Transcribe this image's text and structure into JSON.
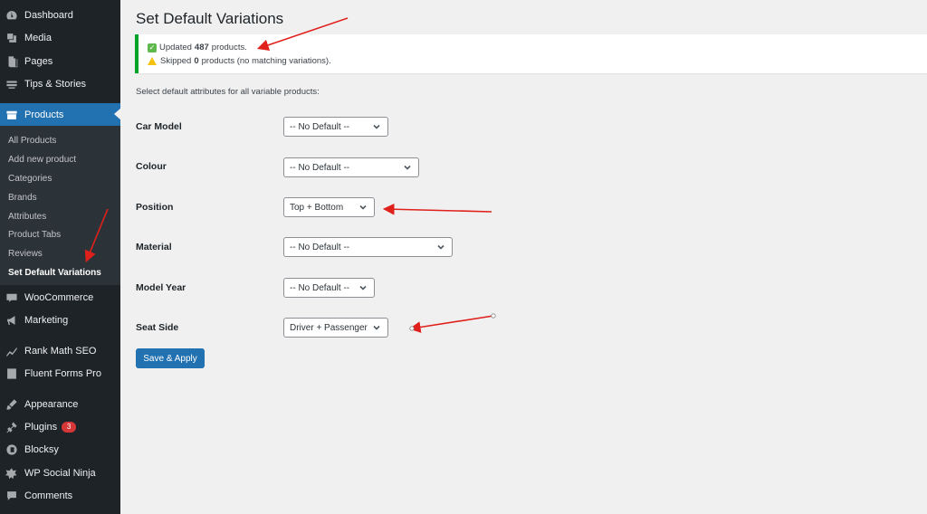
{
  "sidebar": {
    "items_top": [
      {
        "label": "Dashboard",
        "icon": "dashboard-icon"
      },
      {
        "label": "Media",
        "icon": "media-icon"
      },
      {
        "label": "Pages",
        "icon": "pages-icon"
      },
      {
        "label": "Tips & Stories",
        "icon": "tips-icon"
      }
    ],
    "active": {
      "label": "Products",
      "icon": "products-icon"
    },
    "submenu": [
      {
        "label": "All Products"
      },
      {
        "label": "Add new product"
      },
      {
        "label": "Categories"
      },
      {
        "label": "Brands"
      },
      {
        "label": "Attributes"
      },
      {
        "label": "Product Tabs"
      },
      {
        "label": "Reviews"
      },
      {
        "label": "Set Default Variations",
        "current": true
      }
    ],
    "items_bottom": [
      {
        "label": "WooCommerce",
        "icon": "woocommerce-icon"
      },
      {
        "label": "Marketing",
        "icon": "megaphone-icon"
      },
      {
        "label": "Rank Math SEO",
        "icon": "chart-icon"
      },
      {
        "label": "Fluent Forms Pro",
        "icon": "forms-icon"
      },
      {
        "label": "Appearance",
        "icon": "brush-icon"
      },
      {
        "label": "Plugins",
        "icon": "plugin-icon",
        "badge": "3"
      },
      {
        "label": "Blocksy",
        "icon": "blocksy-icon"
      },
      {
        "label": "WP Social Ninja",
        "icon": "ninja-icon"
      },
      {
        "label": "Comments",
        "icon": "comment-icon"
      }
    ]
  },
  "page": {
    "title": "Set Default Variations",
    "notice": {
      "line1_pre": "Updated",
      "line1_count": "487",
      "line1_post": "products.",
      "line2_pre": "Skipped",
      "line2_count": "0",
      "line2_post": "products (no matching variations)."
    },
    "intro": "Select default attributes for all variable products:",
    "fields": [
      {
        "label": "Car Model",
        "value": "-- No Default --"
      },
      {
        "label": "Colour",
        "value": "-- No Default --"
      },
      {
        "label": "Position",
        "value": "Top + Bottom"
      },
      {
        "label": "Material",
        "value": "-- No Default --"
      },
      {
        "label": "Model Year",
        "value": "-- No Default --"
      },
      {
        "label": "Seat Side",
        "value": "Driver + Passenger"
      }
    ],
    "save_label": "Save & Apply"
  },
  "colors": {
    "accent": "#2271b1",
    "sidebar": "#1d2327",
    "success": "#00a32a",
    "annotation": "#e0201b"
  }
}
